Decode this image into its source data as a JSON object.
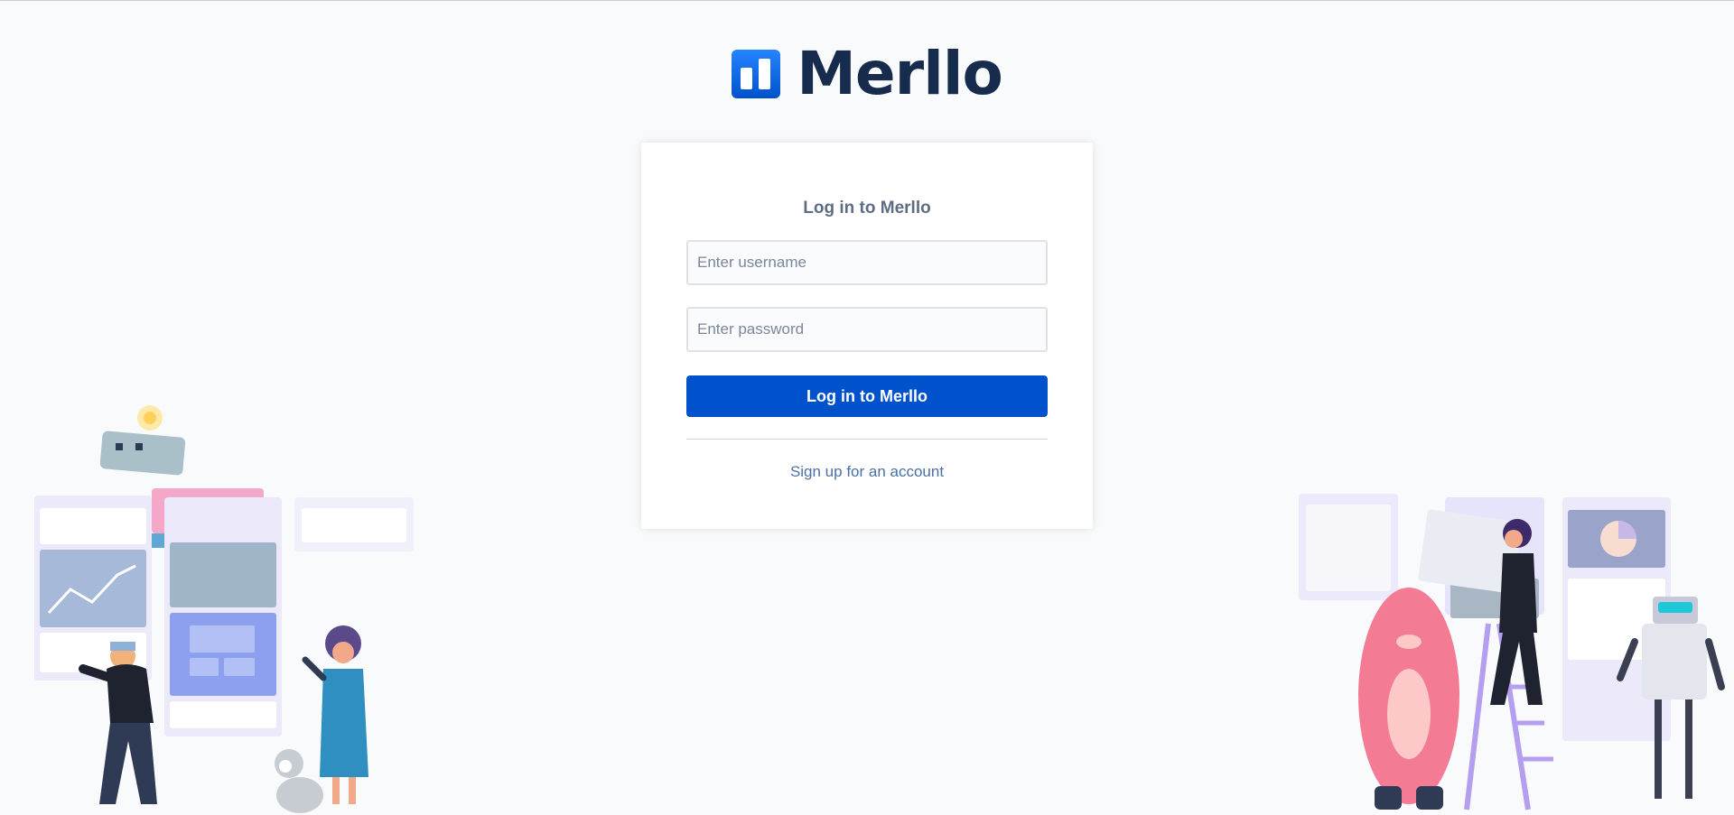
{
  "brand": {
    "name": "Merllo"
  },
  "login": {
    "title": "Log in to Merllo",
    "username_placeholder": "Enter username",
    "password_placeholder": "Enter password",
    "submit_label": "Log in to Merllo",
    "signup_label": "Sign up for an account"
  },
  "colors": {
    "accent": "#0052cc",
    "text_dark": "#172b4d",
    "text_muted": "#5e6c84",
    "background": "#f9fafc"
  },
  "icons": {
    "logo": "board-logo-icon",
    "left_illustration": "team-working-illustration",
    "right_illustration": "team-building-illustration"
  }
}
